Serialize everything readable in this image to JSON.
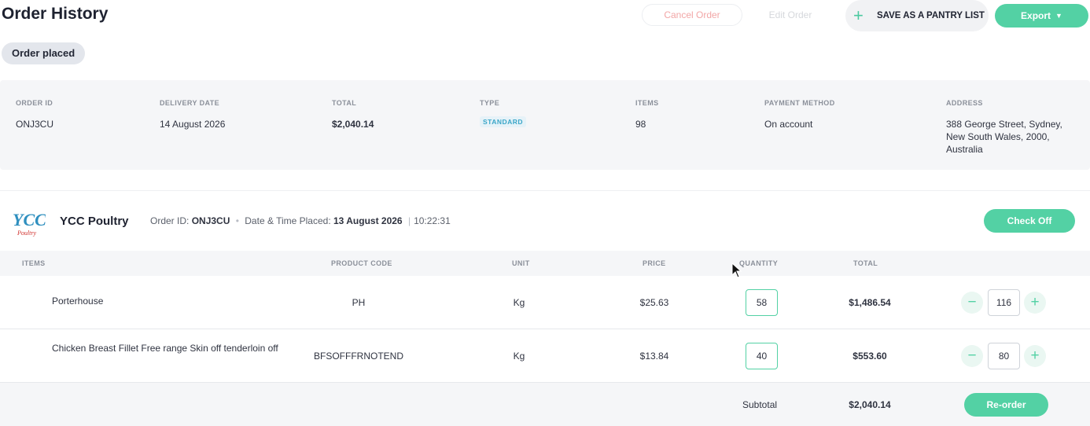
{
  "header": {
    "title": "Order History",
    "status": "Order placed",
    "cancel_label": "Cancel Order",
    "edit_label": "Edit Order",
    "pantry_label": "SAVE AS A PANTRY LIST",
    "export_label": "Export",
    "plus_icon": "plus-icon",
    "chevron_icon": "chevron-down-icon"
  },
  "summary": {
    "order_id_label": "ORDER ID",
    "order_id": "ONJ3CU",
    "delivery_label": "DELIVERY DATE",
    "delivery": "14 August 2026",
    "total_label": "TOTAL",
    "total": "$2,040.14",
    "type_label": "TYPE",
    "type": "STANDARD",
    "items_label": "ITEMS",
    "items": "98",
    "payment_label": "PAYMENT METHOD",
    "payment": "On account",
    "address_label": "ADDRESS",
    "address_line1": "388 George Street, Sydney,",
    "address_line2": "New South Wales, 2000,",
    "address_line3": "Australia"
  },
  "supplier": {
    "logo_text": "YCC",
    "logo_sub": "Poultry",
    "name": "YCC Poultry",
    "order_id_label": "Order ID:",
    "order_id": "ONJ3CU",
    "dot": "•",
    "placed_label": "Date & Time Placed:",
    "placed_date": "13 August 2026",
    "divider": "|",
    "placed_time": "10:22:31",
    "check_off_label": "Check Off"
  },
  "table": {
    "columns": [
      "ITEMS",
      "PRODUCT CODE",
      "UNIT",
      "PRICE",
      "QUANTITY",
      "TOTAL"
    ],
    "rows": [
      {
        "name": "Porterhouse",
        "code": "PH",
        "unit": "Kg",
        "price": "$25.63",
        "quantity": "58",
        "total": "$1,486.54",
        "reorder_qty": "116"
      },
      {
        "name": "Chicken Breast Fillet Free range Skin off tenderloin off",
        "code": "BFSOFFFRNOTEND",
        "unit": "Kg",
        "price": "$13.84",
        "quantity": "40",
        "total": "$553.60",
        "reorder_qty": "80"
      }
    ],
    "minus_symbol": "−",
    "plus_symbol": "+"
  },
  "footer": {
    "subtotal_label": "Subtotal",
    "subtotal": "$2,040.14",
    "reorder_label": "Re-order"
  },
  "colors": {
    "accent": "#53d1a4",
    "cancel_text": "#f2a6a6",
    "badge_text": "#3aa6c8"
  }
}
